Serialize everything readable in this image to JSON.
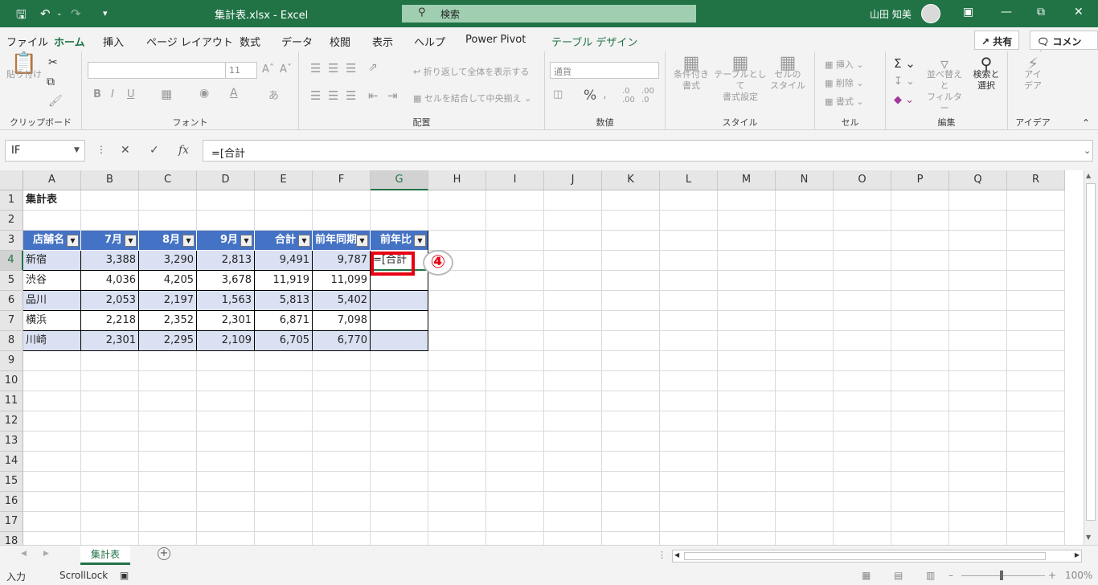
{
  "window": {
    "title": "集計表.xlsx  -  Excel",
    "search_placeholder": "検索",
    "user_name": "山田 知美"
  },
  "menu_tabs": [
    {
      "label": "ファイル"
    },
    {
      "label": "ホーム"
    },
    {
      "label": "挿入"
    },
    {
      "label": "ページ レイアウト"
    },
    {
      "label": "数式"
    },
    {
      "label": "データ"
    },
    {
      "label": "校閲"
    },
    {
      "label": "表示"
    },
    {
      "label": "ヘルプ"
    },
    {
      "label": "Power Pivot"
    },
    {
      "label": "テーブル デザイン"
    }
  ],
  "share_label": "共有",
  "comment_label": "コメント",
  "ribbon": {
    "clipboard": {
      "label": "クリップボード",
      "paste": "貼り付け"
    },
    "font": {
      "label": "フォント",
      "size": "11"
    },
    "alignment": {
      "label": "配置",
      "wrap": "折り返して全体を表示する",
      "merge": "セルを結合して中央揃え"
    },
    "number": {
      "label": "数値",
      "format": "通貨"
    },
    "styles": {
      "label": "スタイル",
      "conditional": "条件付き\n書式",
      "table": "テーブルとして\n書式設定",
      "cell": "セルの\nスタイル"
    },
    "cells": {
      "label": "セル",
      "insert": "挿入",
      "delete": "削除",
      "format": "書式"
    },
    "editing": {
      "label": "編集",
      "sort": "並べ替えと\nフィルター",
      "find": "検索と\n選択"
    },
    "ideas": {
      "label": "アイデア",
      "button": "アイ\nデア"
    }
  },
  "formula_bar": {
    "name_box": "IF",
    "formula": "=[合計"
  },
  "columns": [
    "A",
    "B",
    "C",
    "D",
    "E",
    "F",
    "G",
    "H",
    "I",
    "J",
    "K",
    "L",
    "M",
    "N",
    "O",
    "P",
    "Q",
    "R"
  ],
  "rows": [
    "1",
    "2",
    "3",
    "4",
    "5",
    "6",
    "7",
    "8",
    "9",
    "10",
    "11",
    "12",
    "13",
    "14",
    "15",
    "16",
    "17",
    "18"
  ],
  "sheet": {
    "title": "集計表",
    "headers": [
      "店舗名",
      "7月",
      "8月",
      "9月",
      "合計",
      "前年同期",
      "前年比"
    ],
    "data": [
      [
        "新宿",
        "3,388",
        "3,290",
        "2,813",
        "9,491",
        "9,787",
        "=[合計"
      ],
      [
        "渋谷",
        "4,036",
        "4,205",
        "3,678",
        "11,919",
        "11,099",
        ""
      ],
      [
        "品川",
        "2,053",
        "2,197",
        "1,563",
        "5,813",
        "5,402",
        ""
      ],
      [
        "横浜",
        "2,218",
        "2,352",
        "2,301",
        "6,871",
        "7,098",
        ""
      ],
      [
        "川崎",
        "2,301",
        "2,295",
        "2,109",
        "6,705",
        "6,770",
        ""
      ]
    ]
  },
  "annotation": "④",
  "sheet_tab": "集計表",
  "status": {
    "mode": "入力",
    "scroll_lock": "ScrollLock",
    "zoom": "100%"
  }
}
